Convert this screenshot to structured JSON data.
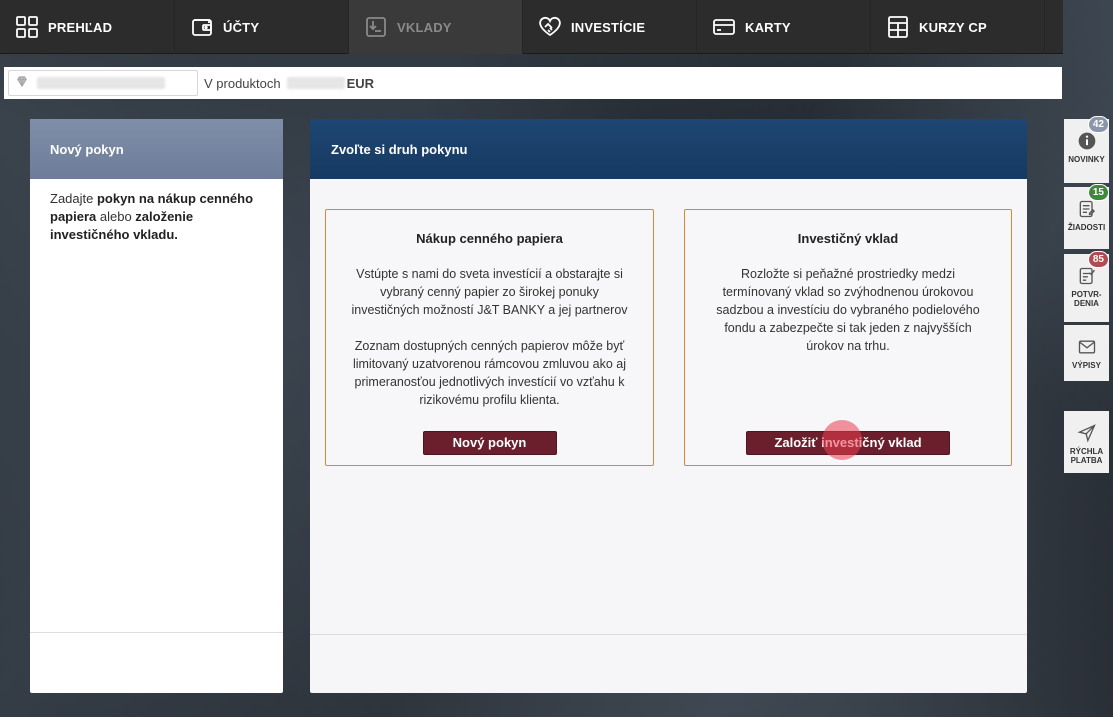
{
  "nav": {
    "items": [
      {
        "label": "PREHĽAD",
        "icon": "grid-icon"
      },
      {
        "label": "ÚČTY",
        "icon": "wallet-icon"
      },
      {
        "label": "VKLADY",
        "icon": "deposit-icon",
        "active": true
      },
      {
        "label": "INVESTÍCIE",
        "icon": "handshake-icon"
      },
      {
        "label": "KARTY",
        "icon": "card-icon"
      },
      {
        "label": "KURZY CP",
        "icon": "table-icon"
      }
    ]
  },
  "infobar": {
    "in_products_label": "V produktoch",
    "currency": "EUR"
  },
  "left_panel": {
    "title": "Nový pokyn",
    "text_1": "Zadajte ",
    "text_bold_1": "pokyn na nákup cenného papiera",
    "text_2": " alebo ",
    "text_bold_2": "založenie investičného vkladu."
  },
  "right_panel": {
    "title": "Zvoľte si druh pokynu",
    "cards": [
      {
        "title": "Nákup cenného papiera",
        "paragraph_1": "Vstúpte s nami do sveta investícií a obstarajte si vybraný cenný papier zo širokej ponuky investičných možností J&T BANKY a jej partnerov",
        "paragraph_2": "Zoznam dostupných cenných papierov môže byť limitovaný uzatvorenou rámcovou zmluvou ako aj primeranosťou jednotlivých investícií vo vzťahu k rizikovému profilu klienta.",
        "button": "Nový pokyn"
      },
      {
        "title": "Investičný vklad",
        "paragraph_1": "Rozložte si peňažné prostriedky medzi termínovaný vklad so zvýhodnenou úrokovou sadzbou a investíciu do vybraného podielového fondu a zabezpečte si tak jeden z najvyšších úrokov na trhu.",
        "button": "Založiť investičný vklad"
      }
    ]
  },
  "sidebar": {
    "items": [
      {
        "label": "NOVINKY",
        "badge": "42",
        "badge_color": "#8a96aa",
        "icon": "info-icon"
      },
      {
        "label": "ŽIADOSTI",
        "badge": "15",
        "badge_color": "#3f8a3a",
        "icon": "form-icon"
      },
      {
        "label": "POTVR-DENIA",
        "label_line1": "POTVR-",
        "label_line2": "DENIA",
        "badge": "85",
        "badge_color": "#b34a52",
        "icon": "confirm-icon"
      },
      {
        "label": "VÝPISY",
        "icon": "envelope-icon"
      },
      {
        "label_line1": "RÝCHLA",
        "label_line2": "PLATBA",
        "icon": "send-icon"
      }
    ]
  }
}
